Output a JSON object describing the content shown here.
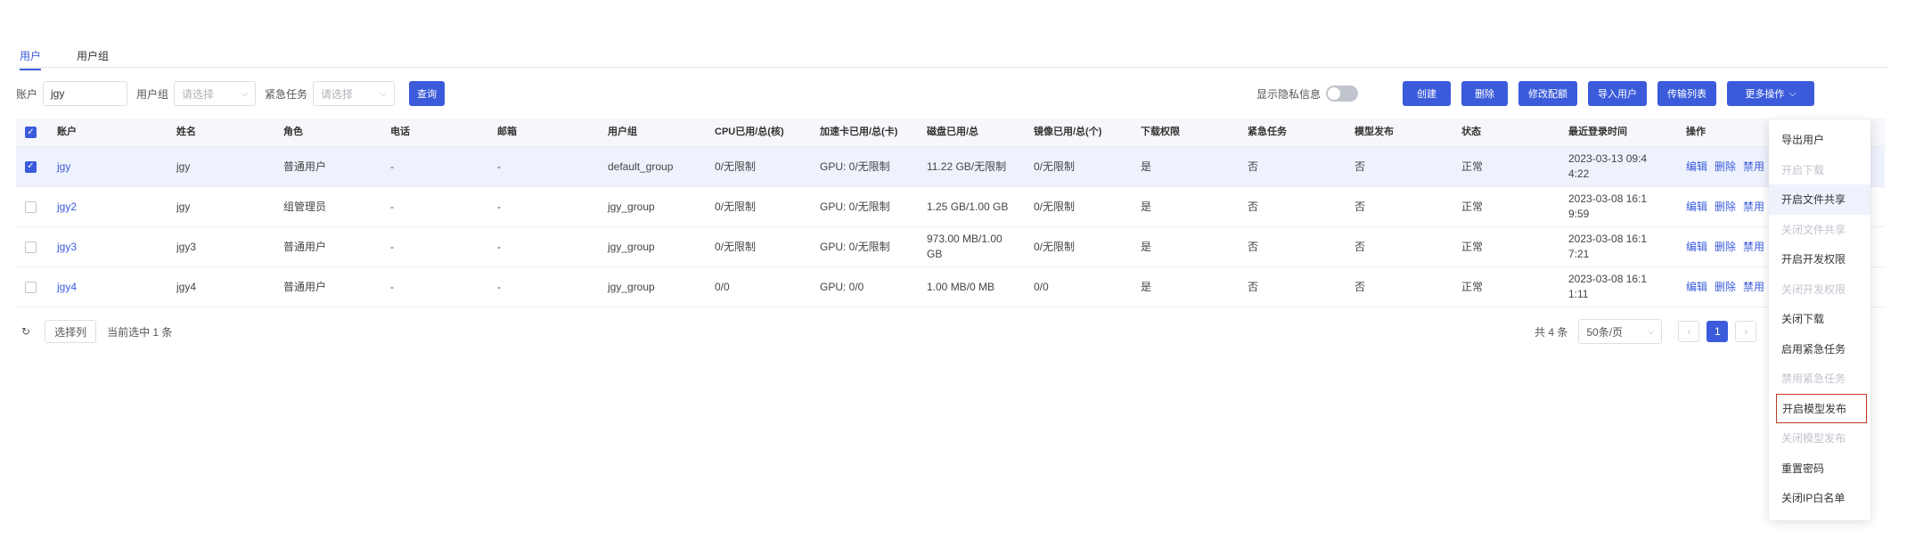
{
  "tabs": [
    "用户",
    "用户组"
  ],
  "filters": {
    "account_label": "账户",
    "account_value": "jgy",
    "group_label": "用户组",
    "group_placeholder": "请选择",
    "urgent_label": "紧急任务",
    "urgent_placeholder": "请选择",
    "query_button": "查询"
  },
  "toolbar": {
    "privacy_label": "显示隐私信息",
    "create": "创建",
    "delete": "删除",
    "modify_quota": "修改配额",
    "import_users": "导入用户",
    "transfer_list": "传输列表",
    "more_actions": "更多操作"
  },
  "table": {
    "columns": [
      "账户",
      "姓名",
      "角色",
      "电话",
      "邮箱",
      "用户组",
      "CPU已用/总(核)",
      "加速卡已用/总(卡)",
      "磁盘已用/总",
      "镜像已用/总(个)",
      "下载权限",
      "紧急任务",
      "模型发布",
      "状态",
      "最近登录时间",
      "操作"
    ],
    "rows": [
      {
        "account": "jgy",
        "name": "jgy",
        "role": "普通用户",
        "phone": "-",
        "email": "-",
        "group": "default_group",
        "cpu": "0/无限制",
        "gpu": "GPU: 0/无限制",
        "disk": "11.22 GB/无限制",
        "image": "0/无限制",
        "download": "是",
        "urgent": "否",
        "model": "否",
        "status": "正常",
        "last_login": "2023-03-13 09:4 4:22",
        "selected": true
      },
      {
        "account": "jgy2",
        "name": "jgy",
        "role": "组管理员",
        "phone": "-",
        "email": "-",
        "group": "jgy_group",
        "cpu": "0/无限制",
        "gpu": "GPU: 0/无限制",
        "disk": "1.25 GB/1.00 GB",
        "image": "0/无限制",
        "download": "是",
        "urgent": "否",
        "model": "否",
        "status": "正常",
        "last_login": "2023-03-08 16:1 9:59",
        "selected": false
      },
      {
        "account": "jgy3",
        "name": "jgy3",
        "role": "普通用户",
        "phone": "-",
        "email": "-",
        "group": "jgy_group",
        "cpu": "0/无限制",
        "gpu": "GPU: 0/无限制",
        "disk": "973.00 MB/1.00 GB",
        "image": "0/无限制",
        "download": "是",
        "urgent": "否",
        "model": "否",
        "status": "正常",
        "last_login": "2023-03-08 16:1 7:21",
        "selected": false
      },
      {
        "account": "jgy4",
        "name": "jgy4",
        "role": "普通用户",
        "phone": "-",
        "email": "-",
        "group": "jgy_group",
        "cpu": "0/0",
        "gpu": "GPU: 0/0",
        "disk": "1.00 MB/0 MB",
        "image": "0/0",
        "download": "是",
        "urgent": "否",
        "model": "否",
        "status": "正常",
        "last_login": "2023-03-08 16:1 1:11",
        "selected": false
      }
    ],
    "row_ops": [
      "编辑",
      "删除",
      "禁用"
    ]
  },
  "footer": {
    "refresh_icon": "refresh-icon",
    "select_columns": "选择列",
    "selected_text": "当前选中 1 条",
    "total_text": "共 4 条",
    "page_size": "50条/页",
    "prev": "‹",
    "current_page": "1",
    "next": "›"
  },
  "menu": {
    "items": [
      {
        "label": "导出用户",
        "state": "normal"
      },
      {
        "label": "开启下载",
        "state": "disabled"
      },
      {
        "label": "开启文件共享",
        "state": "hover"
      },
      {
        "label": "关闭文件共享",
        "state": "disabled"
      },
      {
        "label": "开启开发权限",
        "state": "normal"
      },
      {
        "label": "关闭开发权限",
        "state": "disabled"
      },
      {
        "label": "关闭下载",
        "state": "normal"
      },
      {
        "label": "启用紧急任务",
        "state": "normal"
      },
      {
        "label": "禁用紧急任务",
        "state": "disabled"
      },
      {
        "label": "开启模型发布",
        "state": "highlight"
      },
      {
        "label": "关闭模型发布",
        "state": "disabled"
      },
      {
        "label": "重置密码",
        "state": "normal"
      },
      {
        "label": "关闭IP白名单",
        "state": "normal"
      }
    ]
  },
  "colors": {
    "primary": "#3b5bdb",
    "highlight_border": "#c0392b"
  }
}
